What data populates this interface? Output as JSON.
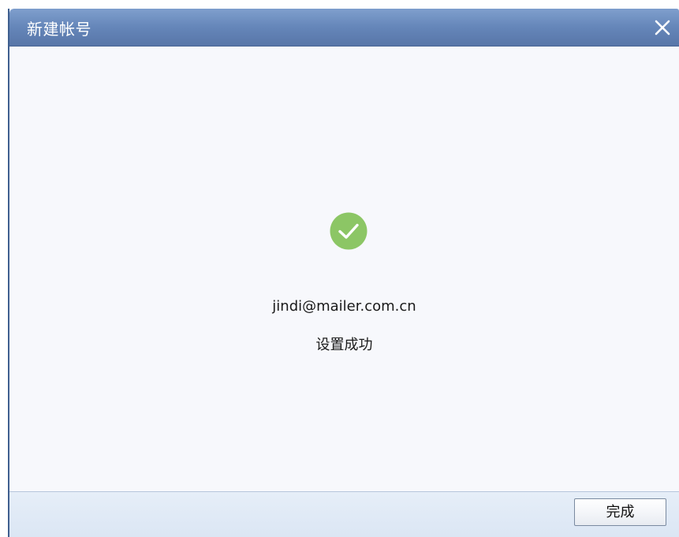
{
  "window": {
    "title": "新建帐号",
    "close_icon": "close-icon"
  },
  "content": {
    "status_icon": "success-check-icon",
    "status_icon_color": "#8cc665",
    "email": "jindi@mailer.com.cn",
    "message": "设置成功"
  },
  "footer": {
    "done_label": "完成"
  },
  "colors": {
    "titlebar": "#6586b9",
    "content_bg": "#f7f8fc",
    "footer_bg": "#dbe6f4"
  }
}
